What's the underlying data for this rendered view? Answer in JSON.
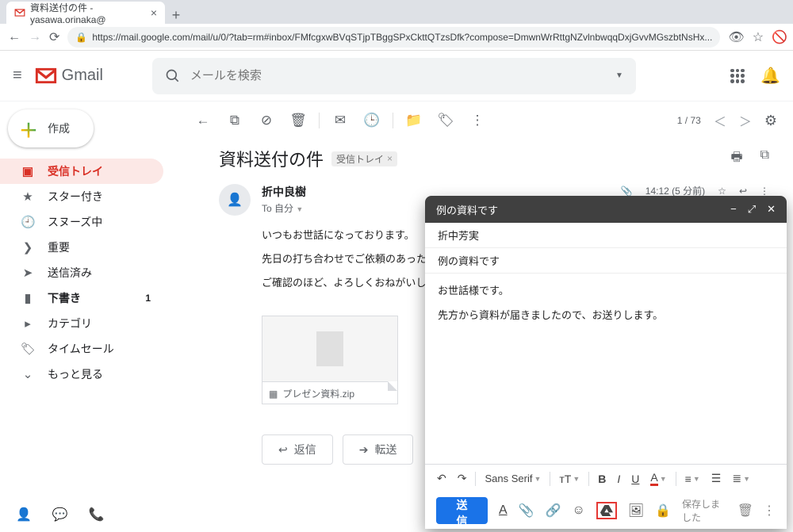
{
  "browser": {
    "tab_title": "資料送付の件 - yasawa.orinaka@",
    "url": "https://mail.google.com/mail/u/0/?tab=rm#inbox/FMfcgxwBVqSTjpTBggSPxCkttQTzsDfk?compose=DmwnWrRttgNZvlnbwqqDxjGvvMGszbtNsHx..."
  },
  "header": {
    "brand": "Gmail",
    "search_placeholder": "メールを検索"
  },
  "sidebar": {
    "compose": "作成",
    "items": [
      {
        "label": "受信トレイ"
      },
      {
        "label": "スター付き"
      },
      {
        "label": "スヌーズ中"
      },
      {
        "label": "重要"
      },
      {
        "label": "送信済み"
      },
      {
        "label": "下書き",
        "count": "1"
      },
      {
        "label": "カテゴリ"
      },
      {
        "label": "タイムセール"
      },
      {
        "label": "もっと見る"
      }
    ]
  },
  "toolbar": {
    "page_counter": "1 / 73"
  },
  "mail": {
    "subject": "資料送付の件",
    "chip": "受信トレイ",
    "from": "折中良樹",
    "to": "To 自分",
    "time": "14:12 (5 分前)",
    "body": [
      "いつもお世話になっております。",
      "先日の打ち合わせでご依頼のあった資料一式を添付",
      "ご確認のほど、よろしくおねがいします。"
    ],
    "attachment": "プレゼン資料.zip",
    "reply": "返信",
    "forward": "転送"
  },
  "compose_win": {
    "title": "例の資料です",
    "to": "折中芳実",
    "subject": "例の資料です",
    "body": [
      "お世話様です。",
      "先方から資料が届きましたので、お送りします。"
    ],
    "font_name": "Sans Serif",
    "send": "送信",
    "saved": "保存しました"
  }
}
